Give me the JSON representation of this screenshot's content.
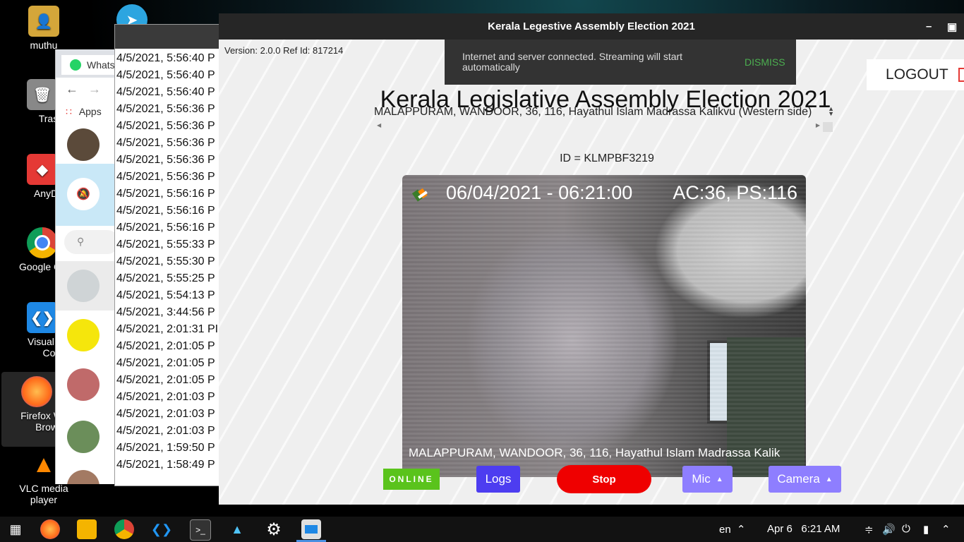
{
  "desktop": {
    "icons": [
      {
        "label": "muthu"
      },
      {
        "label": "Trash"
      },
      {
        "label": "AnyDe"
      },
      {
        "label": "Google Ch"
      },
      {
        "label": "Visual St\nCode"
      },
      {
        "label": "Firefox W\nBrows"
      },
      {
        "label": "VLC media\nplayer"
      }
    ]
  },
  "chrome_window": {
    "tab_label": "Whats",
    "apps_label": "Apps"
  },
  "log_window": {
    "entries": [
      "4/5/2021, 5:56:40 P",
      "4/5/2021, 5:56:40 P",
      "4/5/2021, 5:56:40 P",
      "4/5/2021, 5:56:36 P",
      "4/5/2021, 5:56:36 P",
      "4/5/2021, 5:56:36 P",
      "4/5/2021, 5:56:36 P",
      "4/5/2021, 5:56:36 P",
      "4/5/2021, 5:56:16 P",
      "4/5/2021, 5:56:16 P",
      "4/5/2021, 5:56:16 P",
      "4/5/2021, 5:55:33 P",
      "4/5/2021, 5:55:30 P",
      "4/5/2021, 5:55:25 P",
      "4/5/2021, 5:54:13 P",
      "4/5/2021, 3:44:56 P",
      "4/5/2021, 2:01:31 PI",
      "4/5/2021, 2:01:05 P",
      "4/5/2021, 2:01:05 P",
      "4/5/2021, 2:01:05 P",
      "4/5/2021, 2:01:03 P",
      "4/5/2021, 2:01:03 P",
      "4/5/2021, 2:01:03 P",
      "4/5/2021, 1:59:50 P",
      "4/5/2021, 1:58:49 P"
    ]
  },
  "app": {
    "window_title": "Kerala Legestive Assembly Election 2021",
    "version_text": "Version: 2.0.0 Ref Id: 817214",
    "toast": {
      "message": "Internet and server connected. Streaming will start automatically",
      "action": "DISMISS"
    },
    "logout_label": "LOGOUT",
    "main_title": "Kerala Legislative Assembly Election 2021",
    "station_value": "MALAPPURAM, WANDOOR, 36, 116, Hayathul Islam Madrassa Kalikvu (Western side)",
    "camera_id": "ID = KLMPBF3219",
    "video": {
      "timestamp": "06/04/2021 - 06:21:00",
      "ac_ps": "AC:36, PS:116",
      "caption": "MALAPPURAM, WANDOOR, 36, 116, Hayathul Islam Madrassa Kalik"
    },
    "controls": {
      "status": "ONLINE",
      "logs": "Logs",
      "stop": "Stop",
      "mic": "Mic",
      "camera": "Camera"
    },
    "colors": {
      "online": "#5ac31c",
      "logs": "#4d3df0",
      "stop": "#ef0000",
      "mic_camera": "#8e7eff",
      "toast_action": "#4caf50"
    }
  },
  "taskbar": {
    "language": "en",
    "datetime": "Apr 6   6:21 AM",
    "apps": [
      "apps-menu-icon",
      "firefox-icon",
      "files-icon",
      "chrome-icon",
      "vscode-icon",
      "terminal-icon",
      "image-viewer-icon",
      "settings-icon",
      "election-app-icon"
    ]
  }
}
